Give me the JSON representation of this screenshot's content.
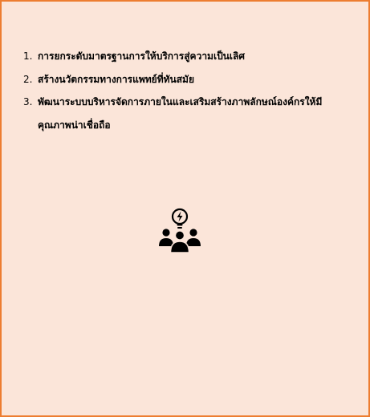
{
  "goals": {
    "items": [
      {
        "number": "1.",
        "text": "การยกระดับมาตรฐานการให้บริการสู่ความเป็นเลิศ"
      },
      {
        "number": "2.",
        "text": "สร้างนวัตกรรมทางการแพทย์ที่ทันสมัย"
      },
      {
        "number": "3.",
        "text": "พัฒนาระบบบริหารจัดการภายในและเสริมสร้างภาพลักษณ์องค์กรให้มีคุณภาพน่าเชื่อถือ"
      }
    ]
  },
  "graphic": {
    "icon": "team-idea-icon",
    "background_color": "#fbe5d9",
    "border_color": "#ed7d31",
    "icon_color": "#000000"
  }
}
